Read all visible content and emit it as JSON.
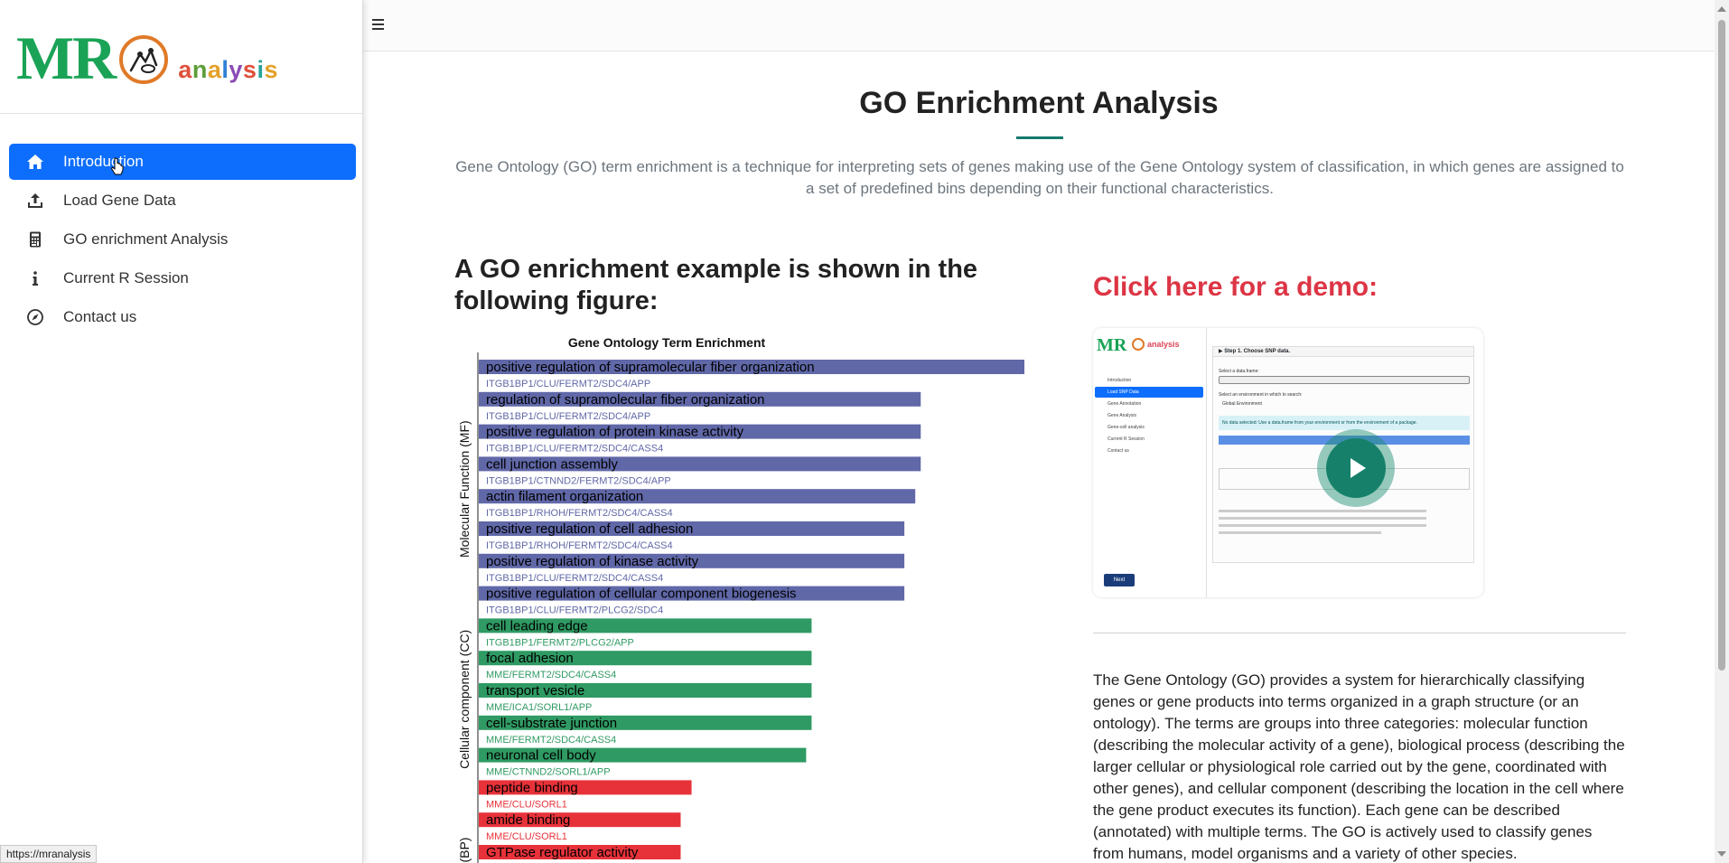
{
  "logo": {
    "mr": "MR",
    "analysis_letters": [
      "a",
      "n",
      "a",
      "l",
      "y",
      "s",
      "i",
      "s"
    ],
    "analysis_colors": [
      "#e0503a",
      "#5c9e3a",
      "#e2a12a",
      "#2f7fd6",
      "#8b4bb5",
      "#e0503a",
      "#2aa39a",
      "#e2a12a"
    ]
  },
  "sidebar": {
    "items": [
      {
        "label": "Introduction",
        "icon": "home-icon",
        "active": true
      },
      {
        "label": "Load Gene Data",
        "icon": "upload-icon",
        "active": false
      },
      {
        "label": "GO enrichment Analysis",
        "icon": "calculator-icon",
        "active": false
      },
      {
        "label": "Current R Session",
        "icon": "info-icon",
        "active": false
      },
      {
        "label": "Contact us",
        "icon": "compass-icon",
        "active": false
      }
    ]
  },
  "status_url": "https://mranalysis",
  "main": {
    "title": "GO Enrichment Analysis",
    "intro": "Gene Ontology (GO) term enrichment is a technique for interpreting sets of genes making use of the Gene Ontology system of classification, in which genes are assigned to a set of predefined bins depending on their functional characteristics.",
    "example_heading": "A GO enrichment example is shown in the following figure:",
    "demo_link": "Click here for a demo:",
    "go_paragraph": "The Gene Ontology (GO) provides a system for hierarchically classifying genes or gene products into terms organized in a graph structure (or an ontology). The terms are groups into three categories: molecular function (describing the molecular activity of a gene), biological process (describing the larger cellular or physiological role carried out by the gene, coordinated with other genes), and cellular component (describing the location in the cell where the gene product executes its function). Each gene can be described (annotated) with multiple terms. The GO is actively used to classify genes from humans, model organisms and a variety of other species."
  },
  "demo": {
    "logo_mr": "MR",
    "logo_analysis": "analysis",
    "nav": [
      "Introduction",
      "Load SNP Data",
      "Gene Annotation",
      "Gene Analysis",
      "Gene-cell analysis",
      "Current R Session",
      "Contact us"
    ],
    "panel_header": "▶  Step 1. Choose SNP data.",
    "select_label": "Select a data.frame:",
    "env_label": "Select an environment in which to search:",
    "env_value": "Global Environment",
    "info_text": "No data selected: Use a data.frame from your environment or from the environment of a package.",
    "next_label": "Next"
  },
  "chart_data": {
    "type": "bar",
    "orientation": "horizontal",
    "title": "Gene Ontology Term Enrichment",
    "groups": [
      {
        "name": "Molecular Function (MF)",
        "color": "#6068a8"
      },
      {
        "name": "Cellular component (CC)",
        "color": "#2f9a63"
      },
      {
        "name": "s (BP)",
        "color": "#e8323a"
      }
    ],
    "categories": [
      {
        "term": "positive regulation of supramolecular fiber organization",
        "genes": "ITGB1BP1/CLU/FERMT2/SDC4/APP",
        "group": 0,
        "value": 100
      },
      {
        "term": "regulation of supramolecular fiber organization",
        "genes": "ITGB1BP1/CLU/FERMT2/SDC4/APP",
        "group": 0,
        "value": 81
      },
      {
        "term": "positive regulation of protein kinase activity",
        "genes": "ITGB1BP1/CLU/FERMT2/SDC4/CASS4",
        "group": 0,
        "value": 81
      },
      {
        "term": "cell junction assembly",
        "genes": "ITGB1BP1/CTNND2/FERMT2/SDC4/APP",
        "group": 0,
        "value": 81
      },
      {
        "term": "actin filament organization",
        "genes": "ITGB1BP1/RHOH/FERMT2/SDC4/CASS4",
        "group": 0,
        "value": 80
      },
      {
        "term": "positive regulation of cell adhesion",
        "genes": "ITGB1BP1/RHOH/FERMT2/SDC4/CASS4",
        "group": 0,
        "value": 78
      },
      {
        "term": "positive regulation of kinase activity",
        "genes": "ITGB1BP1/CLU/FERMT2/SDC4/CASS4",
        "group": 0,
        "value": 78
      },
      {
        "term": "positive regulation of cellular component biogenesis",
        "genes": "ITGB1BP1/CLU/FERMT2/PLCG2/SDC4",
        "group": 0,
        "value": 78
      },
      {
        "term": "cell leading edge",
        "genes": "ITGB1BP1/FERMT2/PLCG2/APP",
        "group": 1,
        "value": 61
      },
      {
        "term": "focal adhesion",
        "genes": "MME/FERMT2/SDC4/CASS4",
        "group": 1,
        "value": 61
      },
      {
        "term": "transport vesicle",
        "genes": "MME/ICA1/SORL1/APP",
        "group": 1,
        "value": 61
      },
      {
        "term": "cell-substrate junction",
        "genes": "MME/FERMT2/SDC4/CASS4",
        "group": 1,
        "value": 61
      },
      {
        "term": "neuronal cell body",
        "genes": "MME/CTNND2/SORL1/APP",
        "group": 1,
        "value": 60
      },
      {
        "term": "peptide binding",
        "genes": "MME/CLU/SORL1",
        "group": 2,
        "value": 39
      },
      {
        "term": "amide binding",
        "genes": "MME/CLU/SORL1",
        "group": 2,
        "value": 37
      },
      {
        "term": "GTPase regulator activity",
        "genes": "",
        "group": 2,
        "value": 37
      }
    ]
  }
}
